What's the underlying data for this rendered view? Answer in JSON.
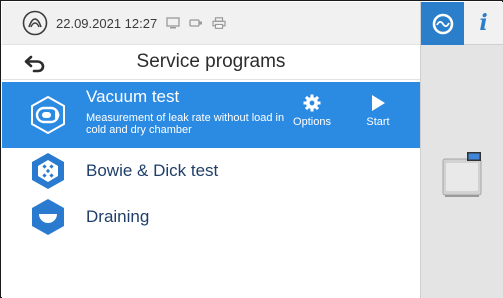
{
  "status_bar": {
    "datetime": "22.09.2021 12:27",
    "icons": [
      "logo-icon",
      "monitor-icon",
      "usb-stick-icon",
      "printer-icon"
    ]
  },
  "sidebar": {
    "program_button_icon": "program-cycle-icon",
    "info_label": "i",
    "device_image": "autoclave-image"
  },
  "header": {
    "back_icon": "back-arrow-icon",
    "title": "Service programs"
  },
  "programs": [
    {
      "name": "Vacuum test",
      "description": "Measurement of leak rate without load in cold and dry chamber",
      "icon": "vacuum-test-icon",
      "selected": true,
      "actions": [
        {
          "label": "Options",
          "icon": "gear-icon"
        },
        {
          "label": "Start",
          "icon": "play-icon"
        }
      ]
    },
    {
      "name": "Bowie & Dick test",
      "icon": "bowie-dick-icon",
      "selected": false
    },
    {
      "name": "Draining",
      "icon": "draining-icon",
      "selected": false
    }
  ],
  "colors": {
    "accent": "#2b8ae2",
    "sidebar_button": "#2b7fca",
    "icon_blue": "#2a7bd0",
    "status_bg": "#f1f1f1",
    "sidebar_bg": "#e4e4e4"
  }
}
